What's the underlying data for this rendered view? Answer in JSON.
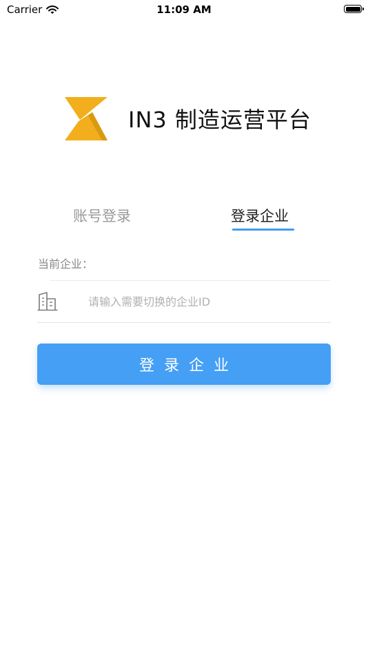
{
  "status_bar": {
    "carrier": "Carrier",
    "time": "11:09 AM"
  },
  "app": {
    "title": "IN3 制造运营平台",
    "logo_color": "#F2AE1C"
  },
  "tabs": [
    {
      "label": "账号登录",
      "active": false
    },
    {
      "label": "登录企业",
      "active": true
    }
  ],
  "form": {
    "current_label": "当前企业：",
    "company_id": {
      "value": "",
      "placeholder": "请输入需要切换的企业ID"
    },
    "submit_label": "登录企业"
  },
  "colors": {
    "accent": "#449FF5",
    "logo": "#F2AE1C"
  }
}
